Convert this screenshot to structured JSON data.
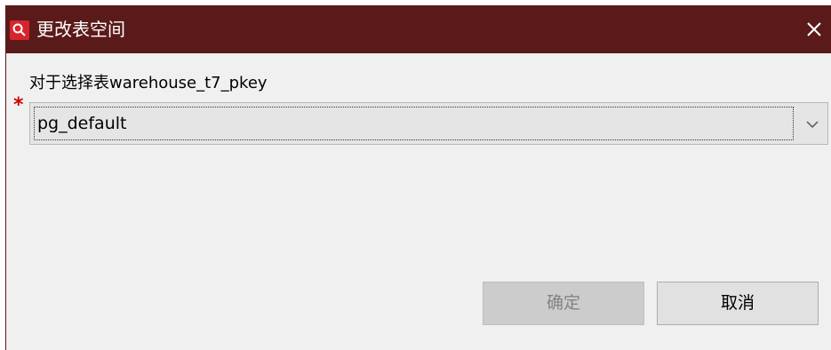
{
  "window": {
    "title": "更改表空间",
    "close_label": "×",
    "colors": {
      "titlebar": "#5b1a1a",
      "icon": "#d6262b",
      "body": "#f0f0f0"
    }
  },
  "form": {
    "prompt": "对于选择表warehouse_t7_pkey",
    "required_mark": "*",
    "tablespace_selected": "pg_default"
  },
  "buttons": {
    "ok_label": "确定",
    "cancel_label": "取消"
  },
  "icons": {
    "app": "app-logo-icon",
    "close": "close-icon",
    "dropdown": "chevron-down-icon"
  }
}
